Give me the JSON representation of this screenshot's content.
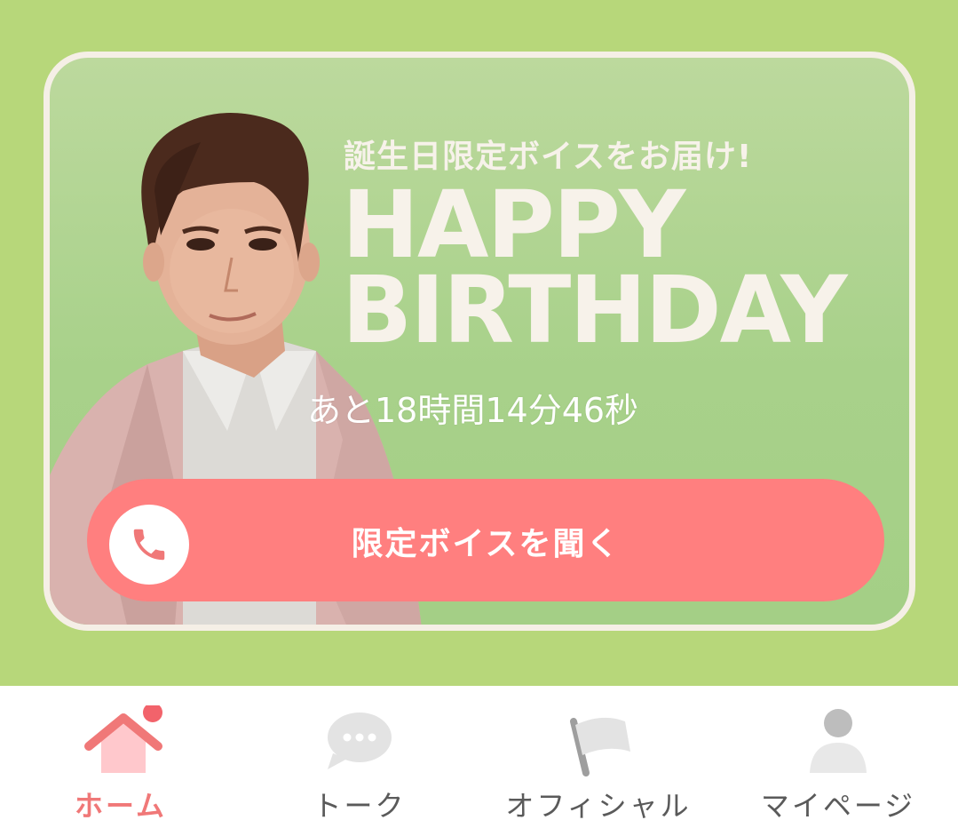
{
  "banner": {
    "subtitle": "誕生日限定ボイスをお届け!",
    "headline_line1": "HAPPY",
    "headline_line2": "BIRTHDAY",
    "countdown": "あと18時間14分46秒",
    "button_label": "限定ボイスを聞く"
  },
  "tabs": [
    {
      "label": "ホーム",
      "icon": "home-icon",
      "active": true
    },
    {
      "label": "トーク",
      "icon": "chat-bubble-icon",
      "active": false
    },
    {
      "label": "オフィシャル",
      "icon": "flag-icon",
      "active": false
    },
    {
      "label": "マイページ",
      "icon": "person-icon",
      "active": false
    }
  ],
  "colors": {
    "background": "#b7d77a",
    "card_border": "#f5efe6",
    "button": "#ff7f7f",
    "active_tab": "#f07878",
    "badge": "#f2636b"
  }
}
